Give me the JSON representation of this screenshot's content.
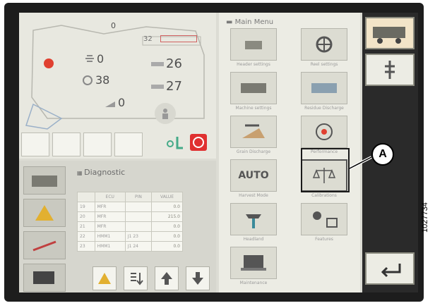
{
  "top_panel": {
    "top_value": "0",
    "speed": "32",
    "fan": "0",
    "reel_speed": "38",
    "header_angle": "0",
    "header_height": "26",
    "header_tilt": "27"
  },
  "diagnostic": {
    "title": "Diagnostic",
    "columns": [
      "ECU",
      "PIN",
      "VALUE"
    ],
    "rows": [
      {
        "id": "19",
        "ecu": "MFR",
        "pin": "",
        "value": "0.0"
      },
      {
        "id": "20",
        "ecu": "MFR",
        "pin": "",
        "value": "215.0"
      },
      {
        "id": "21",
        "ecu": "MFR",
        "pin": "",
        "value": "0.0"
      },
      {
        "id": "22",
        "ecu": "HMM1",
        "pin": "J1 23",
        "value": "0.0"
      },
      {
        "id": "23",
        "ecu": "HMM1",
        "pin": "J1 24",
        "value": "0.0"
      }
    ]
  },
  "main_menu": {
    "title": "Main Menu",
    "items": [
      {
        "label": "Header settings",
        "icon": "header-settings-icon"
      },
      {
        "label": "Reel settings",
        "icon": "reel-settings-icon"
      },
      {
        "label": "Machine settings",
        "icon": "machine-settings-icon"
      },
      {
        "label": "Residue Discharge",
        "icon": "residue-discharge-icon"
      },
      {
        "label": "Grain Discharge",
        "icon": "grain-discharge-icon"
      },
      {
        "label": "Performance",
        "icon": "performance-icon"
      },
      {
        "label": "Harvest Mode",
        "icon": "harvest-mode-icon"
      },
      {
        "label": "Calibrations",
        "icon": "calibrations-icon"
      },
      {
        "label": "Headland",
        "icon": "headland-icon"
      },
      {
        "label": "Features",
        "icon": "features-icon"
      },
      {
        "label": "Maintenance",
        "icon": "maintenance-icon"
      }
    ],
    "auto_text": "AUTO"
  },
  "callout": {
    "label": "A"
  },
  "figure_id": "1027734"
}
